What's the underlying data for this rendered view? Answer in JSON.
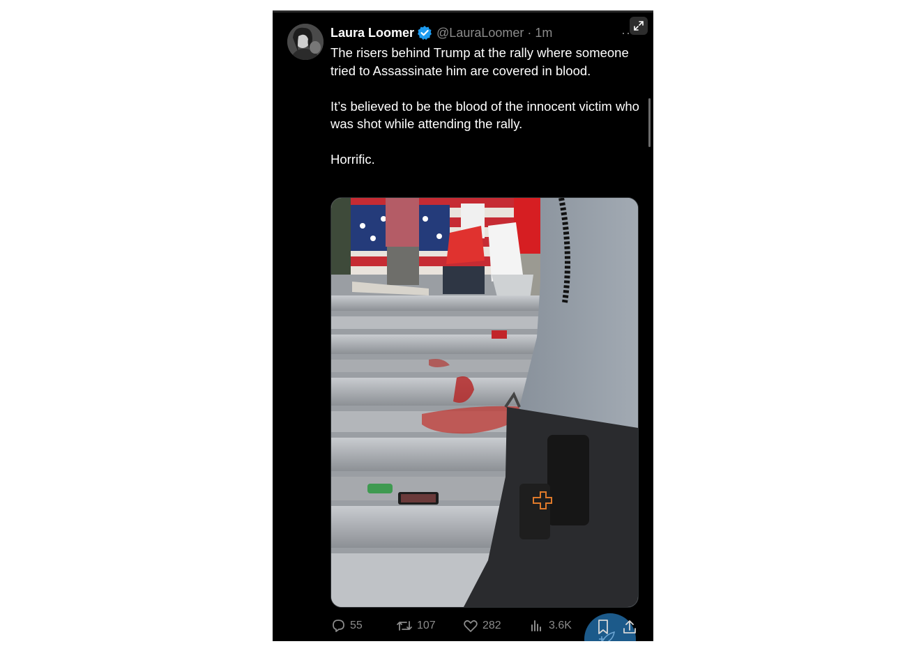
{
  "tweet": {
    "author_name": "Laura Loomer",
    "handle_time": "@LauraLoomer · 1m",
    "more_label": "···",
    "paragraphs": [
      "The risers behind Trump at the rally where someone tried to Assassinate him are covered in blood.",
      "It’s believed to be the blood of the innocent victim who was shot while attending the rally.",
      "Horrific."
    ]
  },
  "actions": {
    "replies": "55",
    "retweets": "107",
    "likes": "282",
    "views": "3.6K"
  },
  "colors": {
    "background": "#000000",
    "text": "#ffffff",
    "muted": "#8b8b8b",
    "verified": "#1d9bf0",
    "fab": "#1d5f91"
  },
  "icons": [
    "verified-badge-icon",
    "more-options-icon",
    "expand-icon",
    "reply-icon",
    "retweet-icon",
    "like-icon",
    "views-icon",
    "bookmark-icon",
    "share-icon",
    "compose-icon"
  ]
}
